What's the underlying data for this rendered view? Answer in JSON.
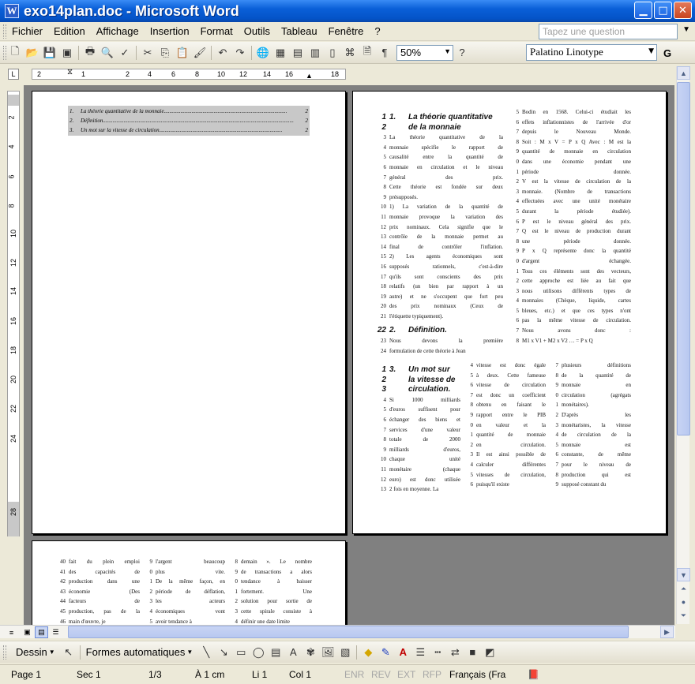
{
  "window": {
    "title": "exo14plan.doc - Microsoft Word",
    "app_icon": "W"
  },
  "menu": [
    "Fichier",
    "Edition",
    "Affichage",
    "Insertion",
    "Format",
    "Outils",
    "Tableau",
    "Fenêtre",
    "?"
  ],
  "help_search": {
    "placeholder": "Tapez une question"
  },
  "toolbar": {
    "zoom": "50%",
    "font": "Palatino Linotype",
    "bold": "G"
  },
  "ruler": {
    "ticks": [
      "2",
      "1",
      "2",
      "4",
      "6",
      "8",
      "10",
      "12",
      "14",
      "16",
      "18"
    ],
    "vticks": [
      "2",
      "4",
      "6",
      "8",
      "10",
      "12",
      "14",
      "16",
      "18",
      "20",
      "22",
      "24",
      "28"
    ]
  },
  "toc": [
    {
      "n": "1.",
      "t": "La théorie quantitative de la monnaie.........................................................................................",
      "p": "2"
    },
    {
      "n": "2.",
      "t": "Définition..........................................................................................................................................",
      "p": "2"
    },
    {
      "n": "3.",
      "t": "Un mot sur la vitesse de circulation.........................................................................................",
      "p": "2"
    }
  ],
  "page2": {
    "h1": {
      "num": "1.",
      "l1": "La théorie quantitative",
      "l2": "de la monnaie"
    },
    "colA": [
      [
        "3",
        "La théorie quantitative de la"
      ],
      [
        "4",
        "monnaie spécifie le rapport de"
      ],
      [
        "5",
        "causalité entre la quantité de"
      ],
      [
        "6",
        "monnaie en circulation et le niveau"
      ],
      [
        "7",
        "général des prix."
      ],
      [
        "8",
        "Cette théorie est fondée sur deux"
      ],
      [
        "9",
        "présupposés."
      ],
      [
        "10",
        "1) La variation de la quantité de"
      ],
      [
        "11",
        "monnaie provoque la variation des"
      ],
      [
        "12",
        "prix nominaux. Cela signifie que le"
      ],
      [
        "13",
        "contrôle de la monnaie permet au"
      ],
      [
        "14",
        "final de contrôler l'inflation."
      ],
      [
        "15",
        "2) Les agents économiques sont"
      ],
      [
        "16",
        "supposés rationnels, c'est-à-dire"
      ],
      [
        "17",
        "qu'ils sont conscients des prix"
      ],
      [
        "18",
        "relatifs (un bien par rapport à un"
      ],
      [
        "19",
        "autre) et ne s'occupent que fort peu"
      ],
      [
        "20",
        "des prix nominaux (Ceux de"
      ],
      [
        "21",
        "l'étiquette typiquement)."
      ]
    ],
    "h2": {
      "ln": "22",
      "num": "2.",
      "text": "Définition."
    },
    "colA2": [
      [
        "23",
        "Nous devons la première"
      ],
      [
        "24",
        "formulation de cette théorie à Jean"
      ]
    ],
    "colB": [
      [
        "5",
        "Bodin en 1568. Celui-ci étudiait les"
      ],
      [
        "6",
        "effets inflationnistes de l'arrivée d'or"
      ],
      [
        "7",
        "depuis le Nouveau Monde."
      ],
      [
        "8",
        "Soit : M x V = P x Q Avec : M est la"
      ],
      [
        "9",
        "quantité de monnaie en circulation"
      ],
      [
        "0",
        "dans une économie pendant une"
      ],
      [
        "1",
        "période donnée."
      ],
      [
        "2",
        "V est la vitesse de circulation de la"
      ],
      [
        "3",
        "monnaie. (Nombre de transactions"
      ],
      [
        "4",
        "effectuées avec une unité monétaire"
      ],
      [
        "5",
        "durant la période étudiée)."
      ],
      [
        "6",
        "P est le niveau général des prix."
      ],
      [
        "7",
        "Q est le niveau de production durant"
      ],
      [
        "8",
        "une période donnée."
      ],
      [
        "9",
        "P x Q représente donc la quantité"
      ],
      [
        "0",
        "d'argent échangée."
      ],
      [
        "1",
        "Tous ces éléments sont des vecteurs,"
      ],
      [
        "2",
        "cette approche est liée au fait que"
      ],
      [
        "3",
        "nous utilisons différents types de"
      ],
      [
        "4",
        "monnaies (Chèque, liquide, cartes"
      ],
      [
        "5",
        "bleues, etc.) et que ces types n'ont"
      ],
      [
        "6",
        "pas la même vitesse de circulation."
      ],
      [
        "7",
        "Nous avons donc :"
      ],
      [
        "8",
        "M1 x V1 + M2 x V2 … = P x Q"
      ]
    ],
    "h3": {
      "num": "3.",
      "l1": "Un mot sur",
      "l2": "la vitesse de",
      "l3": "circulation."
    },
    "c1": [
      [
        "4",
        "Si 1000 milliards"
      ],
      [
        "5",
        "d'euros suffisent pour"
      ],
      [
        "6",
        "échanger des biens et"
      ],
      [
        "7",
        "services d'une valeur"
      ],
      [
        "8",
        "totale de 2000"
      ],
      [
        "9",
        "milliards d'euros,"
      ],
      [
        "10",
        "chaque unité"
      ],
      [
        "11",
        "monétaire (chaque"
      ],
      [
        "12",
        "euro) est donc utilisée"
      ],
      [
        "13",
        "2 fois en moyenne. La"
      ]
    ],
    "c2": [
      [
        "4",
        "vitesse est donc égale"
      ],
      [
        "5",
        "à deux. Cette fameuse"
      ],
      [
        "6",
        "vitesse de circulation"
      ],
      [
        "7",
        "est donc un coefficient"
      ],
      [
        "8",
        "obtenu en faisant le"
      ],
      [
        "9",
        "rapport entre le PIB"
      ],
      [
        "0",
        "en valeur et la"
      ],
      [
        "1",
        "quantité de monnaie"
      ],
      [
        "2",
        "en circulation."
      ],
      [
        "3",
        "Il est ainsi possible de"
      ],
      [
        "4",
        "calculer différentes"
      ],
      [
        "5",
        "vitesses de circulation,"
      ],
      [
        "6",
        "puisqu'il existe"
      ]
    ],
    "c3": [
      [
        "7",
        "plusieurs définitions"
      ],
      [
        "8",
        "de la quantité de"
      ],
      [
        "9",
        "monnaie en"
      ],
      [
        "0",
        "circulation (agrégats"
      ],
      [
        "1",
        "monétaires)."
      ],
      [
        "2",
        "D'après les"
      ],
      [
        "3",
        "monétaristes, la vitesse"
      ],
      [
        "4",
        "de circulation de la"
      ],
      [
        "5",
        "monnaie est"
      ],
      [
        "6",
        "constante, de même"
      ],
      [
        "7",
        "pour le niveau de"
      ],
      [
        "8",
        "production qui est"
      ],
      [
        "9",
        "supposé constant du"
      ]
    ]
  },
  "page3": {
    "c1": [
      [
        "40",
        "fait du plein emploi"
      ],
      [
        "41",
        "des capacités de"
      ],
      [
        "42",
        "production dans une"
      ],
      [
        "43",
        "économie (Des"
      ],
      [
        "44",
        "facteurs de"
      ],
      [
        "45",
        "production, pas de la"
      ],
      [
        "46",
        "main d'œuvre, je"
      ]
    ],
    "c2": [
      [
        "9",
        "l'argent beaucoup"
      ],
      [
        "0",
        "plus vite."
      ],
      [
        "1",
        "De la même façon, en"
      ],
      [
        "2",
        "période de déflation,"
      ],
      [
        "3",
        "les acteurs"
      ],
      [
        "4",
        "économiques vont"
      ],
      [
        "5",
        "avoir tendance à"
      ]
    ],
    "c3": [
      [
        "8",
        "demain ». Le nombre"
      ],
      [
        "9",
        "de transactions a alors"
      ],
      [
        "0",
        "tendance à baisser"
      ],
      [
        "1",
        "fortement. Une"
      ],
      [
        "2",
        "solution pour sortie de"
      ],
      [
        "3",
        "cette spirale consiste à"
      ],
      [
        "4",
        "définir une date limite"
      ]
    ]
  },
  "drawbar": {
    "dessin": "Dessin",
    "formes": "Formes automatiques"
  },
  "status": {
    "page": "Page 1",
    "sec": "Sec 1",
    "frac": "1/3",
    "at": "À 1 cm",
    "li": "Li 1",
    "col": "Col 1",
    "enr": "ENR",
    "rev": "REV",
    "ext": "EXT",
    "rfp": "RFP",
    "lang": "Français (Fra"
  }
}
